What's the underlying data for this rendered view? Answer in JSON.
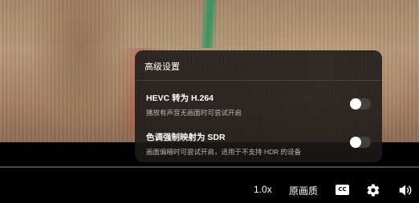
{
  "panel": {
    "title": "高级设置",
    "options": [
      {
        "title": "HEVC 转为 H.264",
        "desc": "播放有声音无画面时可尝试开启",
        "enabled": false
      },
      {
        "title": "色调强制映射为 SDR",
        "desc": "画面偏暗时可尝试开启，适用于不支持 HDR 的设备",
        "enabled": false
      }
    ]
  },
  "controls": {
    "speed": "1.0x",
    "quality": "原画质",
    "cc_icon": "closed-captions-icon",
    "settings_icon": "gear-icon",
    "volume_icon": "volume-icon"
  },
  "colors": {
    "panel_bg": "#1c1a19",
    "toggle_off": "#464646",
    "bar_bg": "#000000"
  }
}
